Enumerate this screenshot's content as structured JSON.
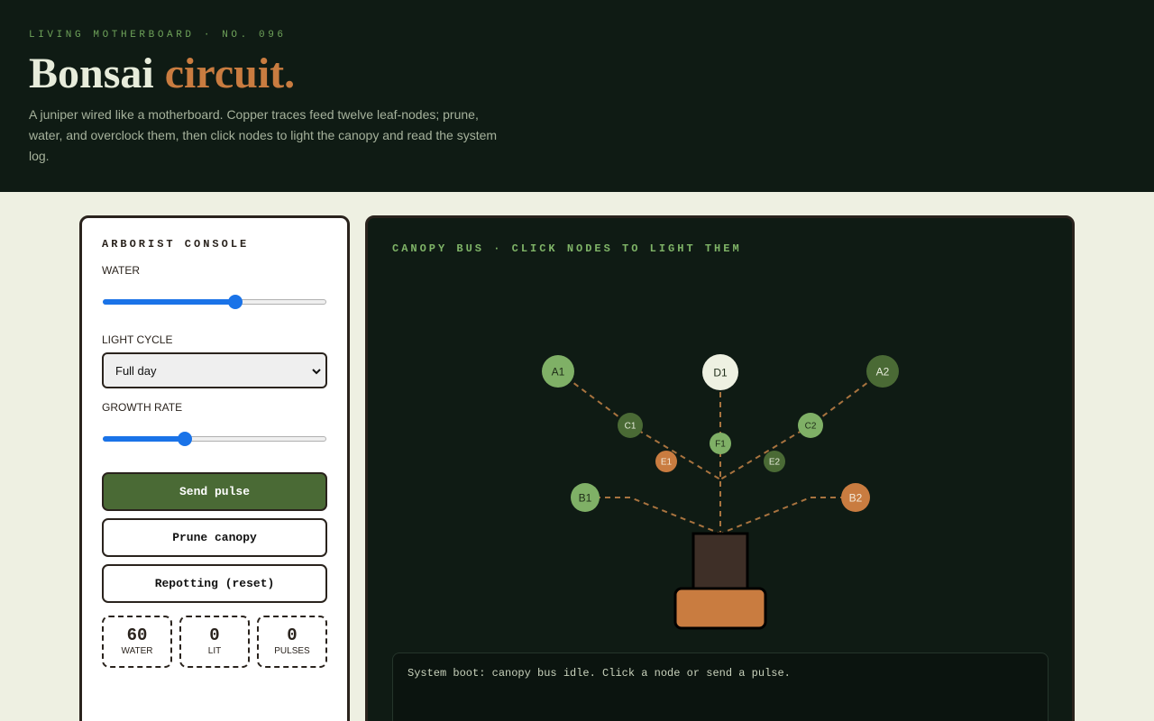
{
  "header": {
    "eyebrow": "LIVING MOTHERBOARD · NO. 096",
    "title_main": "Bonsai",
    "title_accent": "circuit.",
    "intro": "A juniper wired like a motherboard. Copper traces feed twelve leaf-nodes; prune, water, and overclock them, then click nodes to light the canopy and read the system log."
  },
  "console": {
    "title": "ARBORIST CONSOLE",
    "water": {
      "label": "WATER",
      "value": 60,
      "min": 0,
      "max": 100
    },
    "light_cycle": {
      "label": "LIGHT CYCLE",
      "selected": "Full day"
    },
    "growth": {
      "label": "GROWTH RATE",
      "value": 0.36,
      "min": 0,
      "max": 1
    },
    "buttons": {
      "pulse": "Send pulse",
      "prune": "Prune canopy",
      "reset": "Repotting (reset)"
    },
    "stats": [
      {
        "value": "60",
        "label": "WATER"
      },
      {
        "value": "0",
        "label": "LIT"
      },
      {
        "value": "0",
        "label": "PULSES"
      }
    ]
  },
  "canopy": {
    "title": "CANOPY BUS · CLICK NODES TO LIGHT THEM",
    "nodes": [
      {
        "id": "A1",
        "color": "#7fb066",
        "text_color": "#1d2b17"
      },
      {
        "id": "D1",
        "color": "#eef1e2",
        "text_color": "#1d2b17"
      },
      {
        "id": "A2",
        "color": "#4a6a35",
        "text_color": "#e7ecdb"
      },
      {
        "id": "C1",
        "color": "#4a6a35",
        "text_color": "#e7ecdb"
      },
      {
        "id": "C2",
        "color": "#7fb066",
        "text_color": "#1d2b17"
      },
      {
        "id": "F1",
        "color": "#7fb066",
        "text_color": "#1d2b17"
      },
      {
        "id": "E1",
        "color": "#c97c40",
        "text_color": "#f4ead9"
      },
      {
        "id": "E2",
        "color": "#4a6a35",
        "text_color": "#e7ecdb"
      },
      {
        "id": "B1",
        "color": "#7fb066",
        "text_color": "#1d2b17"
      },
      {
        "id": "B2",
        "color": "#c97c40",
        "text_color": "#f4ead9"
      }
    ],
    "log": "System boot: canopy bus idle. Click a node or send a pulse."
  },
  "colors": {
    "trace": "#a8733f",
    "trunk": "#3e2f27",
    "pot": "#c97c40",
    "accent_green": "#4a6a35",
    "copper": "#c97c40"
  }
}
